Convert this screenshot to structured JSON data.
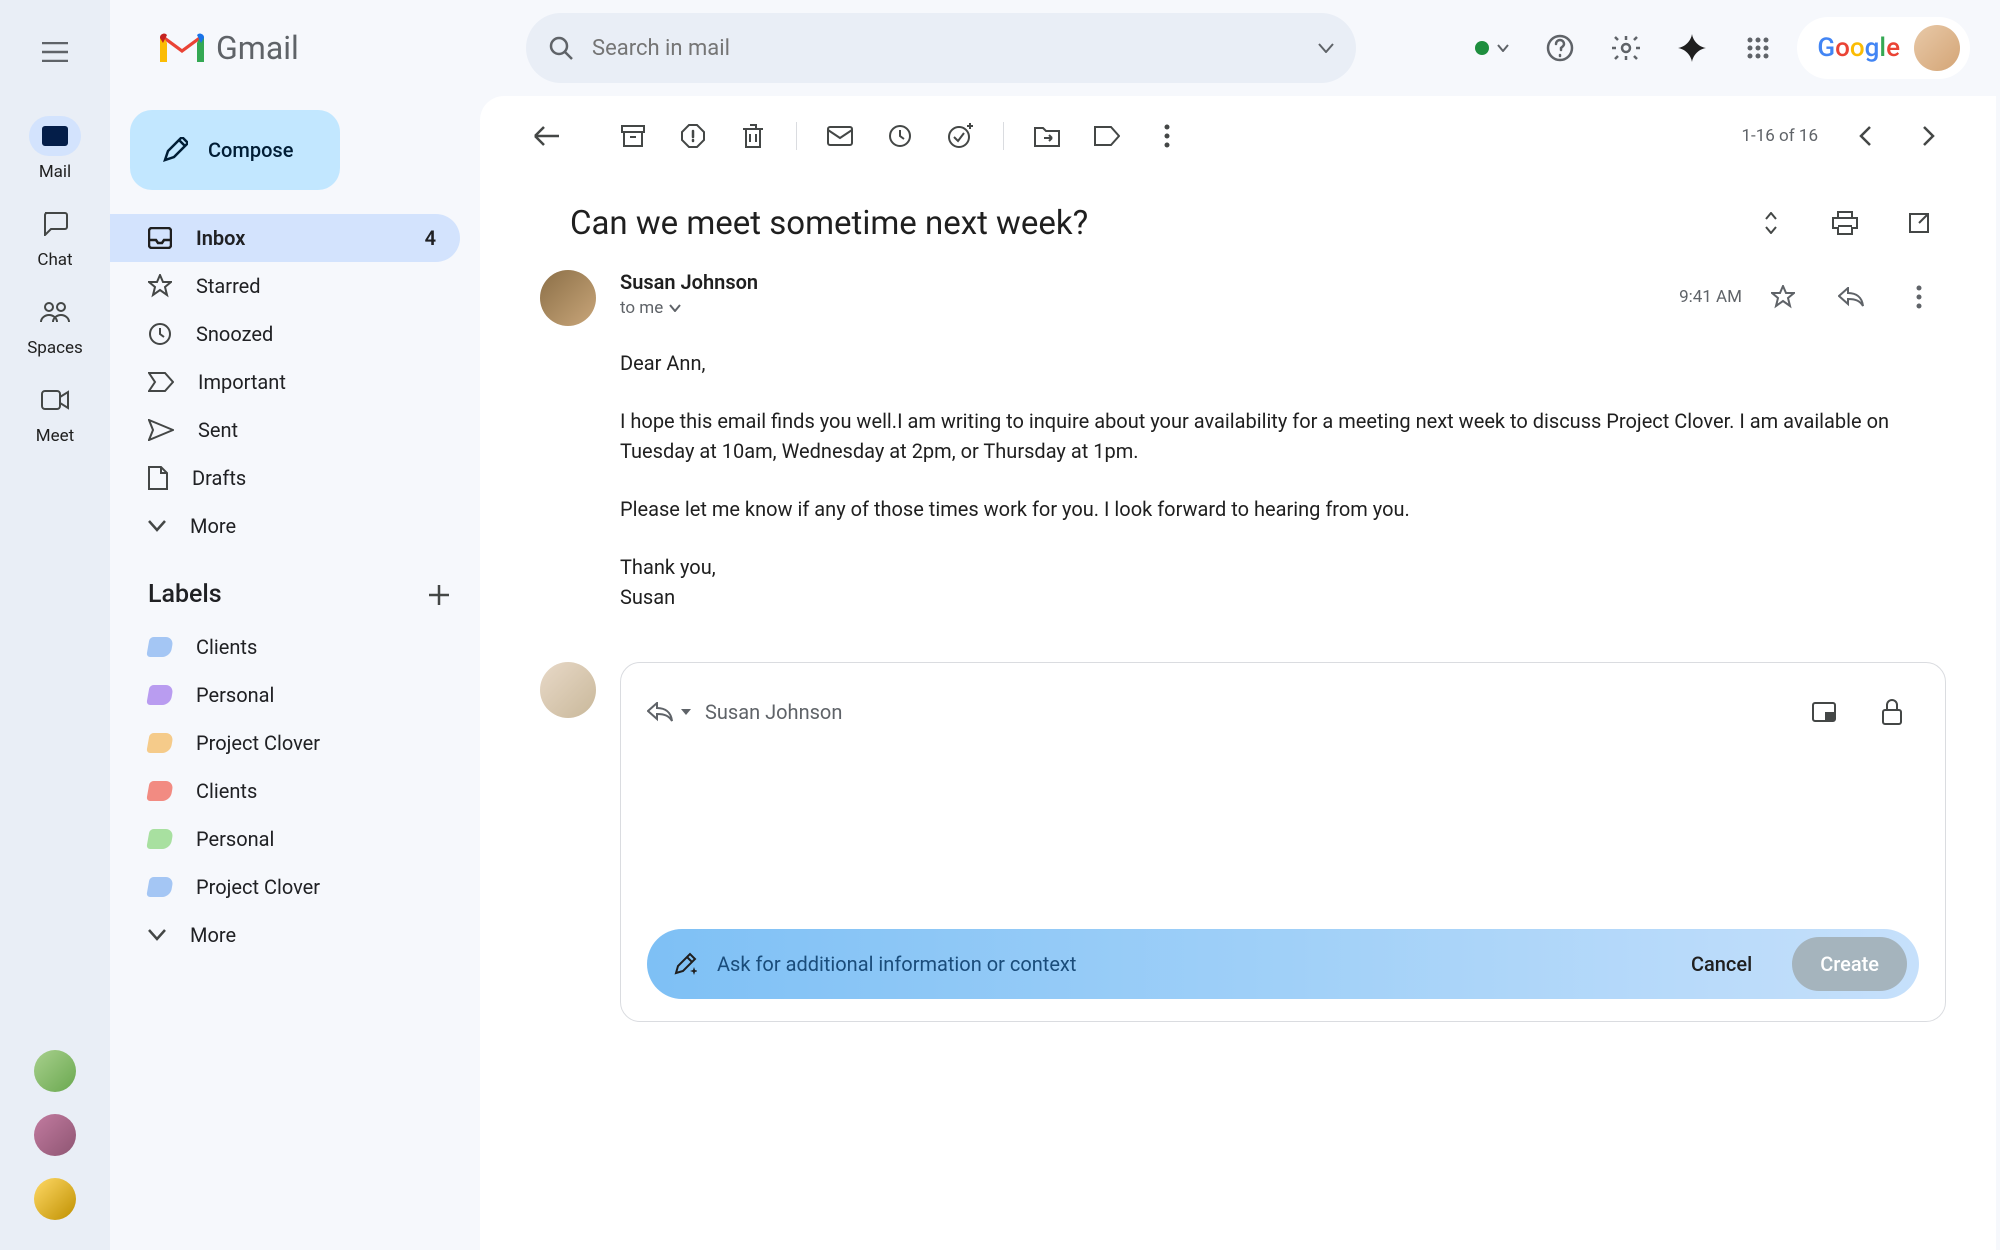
{
  "brand": "Gmail",
  "search": {
    "placeholder": "Search in mail"
  },
  "google_logo_text": "Google",
  "rail": {
    "items": [
      {
        "label": "Mail"
      },
      {
        "label": "Chat"
      },
      {
        "label": "Spaces"
      },
      {
        "label": "Meet"
      }
    ]
  },
  "compose_label": "Compose",
  "nav": {
    "items": [
      {
        "label": "Inbox",
        "count": "4"
      },
      {
        "label": "Starred"
      },
      {
        "label": "Snoozed"
      },
      {
        "label": "Important"
      },
      {
        "label": "Sent"
      },
      {
        "label": "Drafts"
      },
      {
        "label": "More"
      }
    ]
  },
  "labels_header": "Labels",
  "labels": [
    {
      "name": "Clients",
      "color": "#a4c6f4"
    },
    {
      "name": "Personal",
      "color": "#b99cf0"
    },
    {
      "name": "Project Clover",
      "color": "#f5cb8a"
    },
    {
      "name": "Clients",
      "color": "#f28b82"
    },
    {
      "name": "Personal",
      "color": "#a8e0a0"
    },
    {
      "name": "Project Clover",
      "color": "#a4c6f4"
    }
  ],
  "labels_more": "More",
  "page_count": "1-16 of 16",
  "subject": "Can we meet sometime next week?",
  "message": {
    "sender": "Susan Johnson",
    "to": "to me",
    "time": "9:41 AM",
    "greeting": "Dear Ann,",
    "p1": "I hope this email finds you well.I am writing to inquire about your availability for a meeting next week to discuss Project Clover. I am available on Tuesday at 10am, Wednesday at 2pm, or Thursday at 1pm.",
    "p2": "Please let me know if any of those times work for you. I look forward to hearing from you.",
    "closing": "Thank you,",
    "signature": "Susan"
  },
  "reply": {
    "recipient": "Susan Johnson",
    "ai_placeholder": "Ask for additional information or context",
    "cancel": "Cancel",
    "create": "Create"
  }
}
